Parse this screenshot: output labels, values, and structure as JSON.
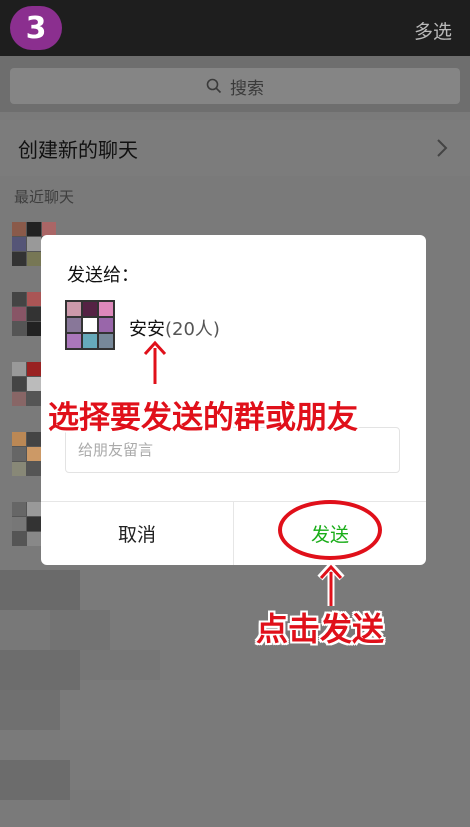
{
  "step_badge": "3",
  "header": {
    "multi_select": "多选"
  },
  "search": {
    "placeholder": "搜索"
  },
  "create_chat": {
    "label": "创建新的聊天"
  },
  "recent": {
    "header": "最近聊天"
  },
  "dialog": {
    "title": "发送给：",
    "group_name": "安安",
    "group_count": "(20人)",
    "message_placeholder": "给朋友留言",
    "cancel_label": "取消",
    "send_label": "发送"
  },
  "annotations": {
    "select_hint": "选择要发送的群或朋友",
    "click_hint": "点击发送"
  },
  "colors": {
    "send_green": "#1aad19",
    "annotation_red": "#e0101a",
    "badge_purple": "#8b2f8f"
  }
}
